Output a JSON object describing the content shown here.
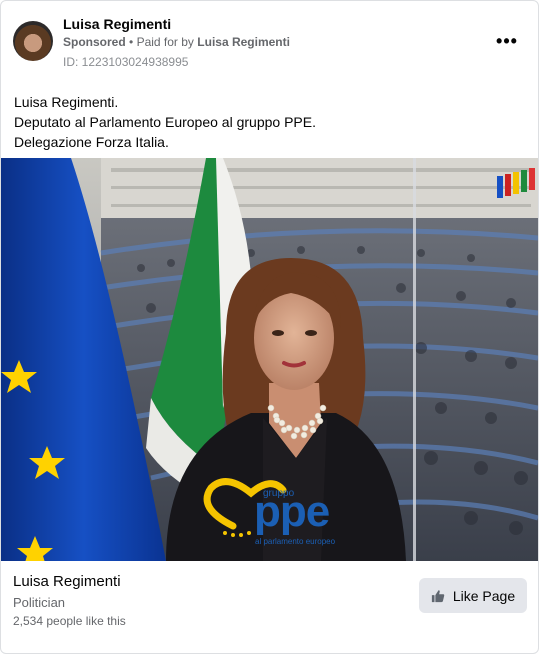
{
  "post": {
    "author": "Luisa Regimenti",
    "sponsored": "Sponsored",
    "separator": "•",
    "paid_for_prefix": "Paid for by",
    "paid_for_name": "Luisa Regimenti",
    "ad_id": "ID: 1223103024938995",
    "text_lines": [
      "Luisa Regimenti.",
      "Deputato al Parlamento Europeo al gruppo PPE.",
      "Delegazione Forza Italia."
    ],
    "more_icon": "more-horizontal-icon"
  },
  "image": {
    "logo_small": "gruppo",
    "logo_big": "ppe",
    "logo_caption": "al parlamento europeo"
  },
  "footer": {
    "page_name": "Luisa Regimenti",
    "category": "Politician",
    "likes": "2,534 people like this",
    "like_button": "Like Page",
    "like_icon": "thumbs-up-icon"
  },
  "colors": {
    "text_primary": "#050505",
    "text_secondary": "#65676b",
    "button_bg": "#e4e6eb",
    "eu_blue": "#0b3ea8",
    "eu_star": "#ffd200",
    "ppe_blue": "#1b5fb4",
    "ppe_yellow": "#f5c400"
  }
}
